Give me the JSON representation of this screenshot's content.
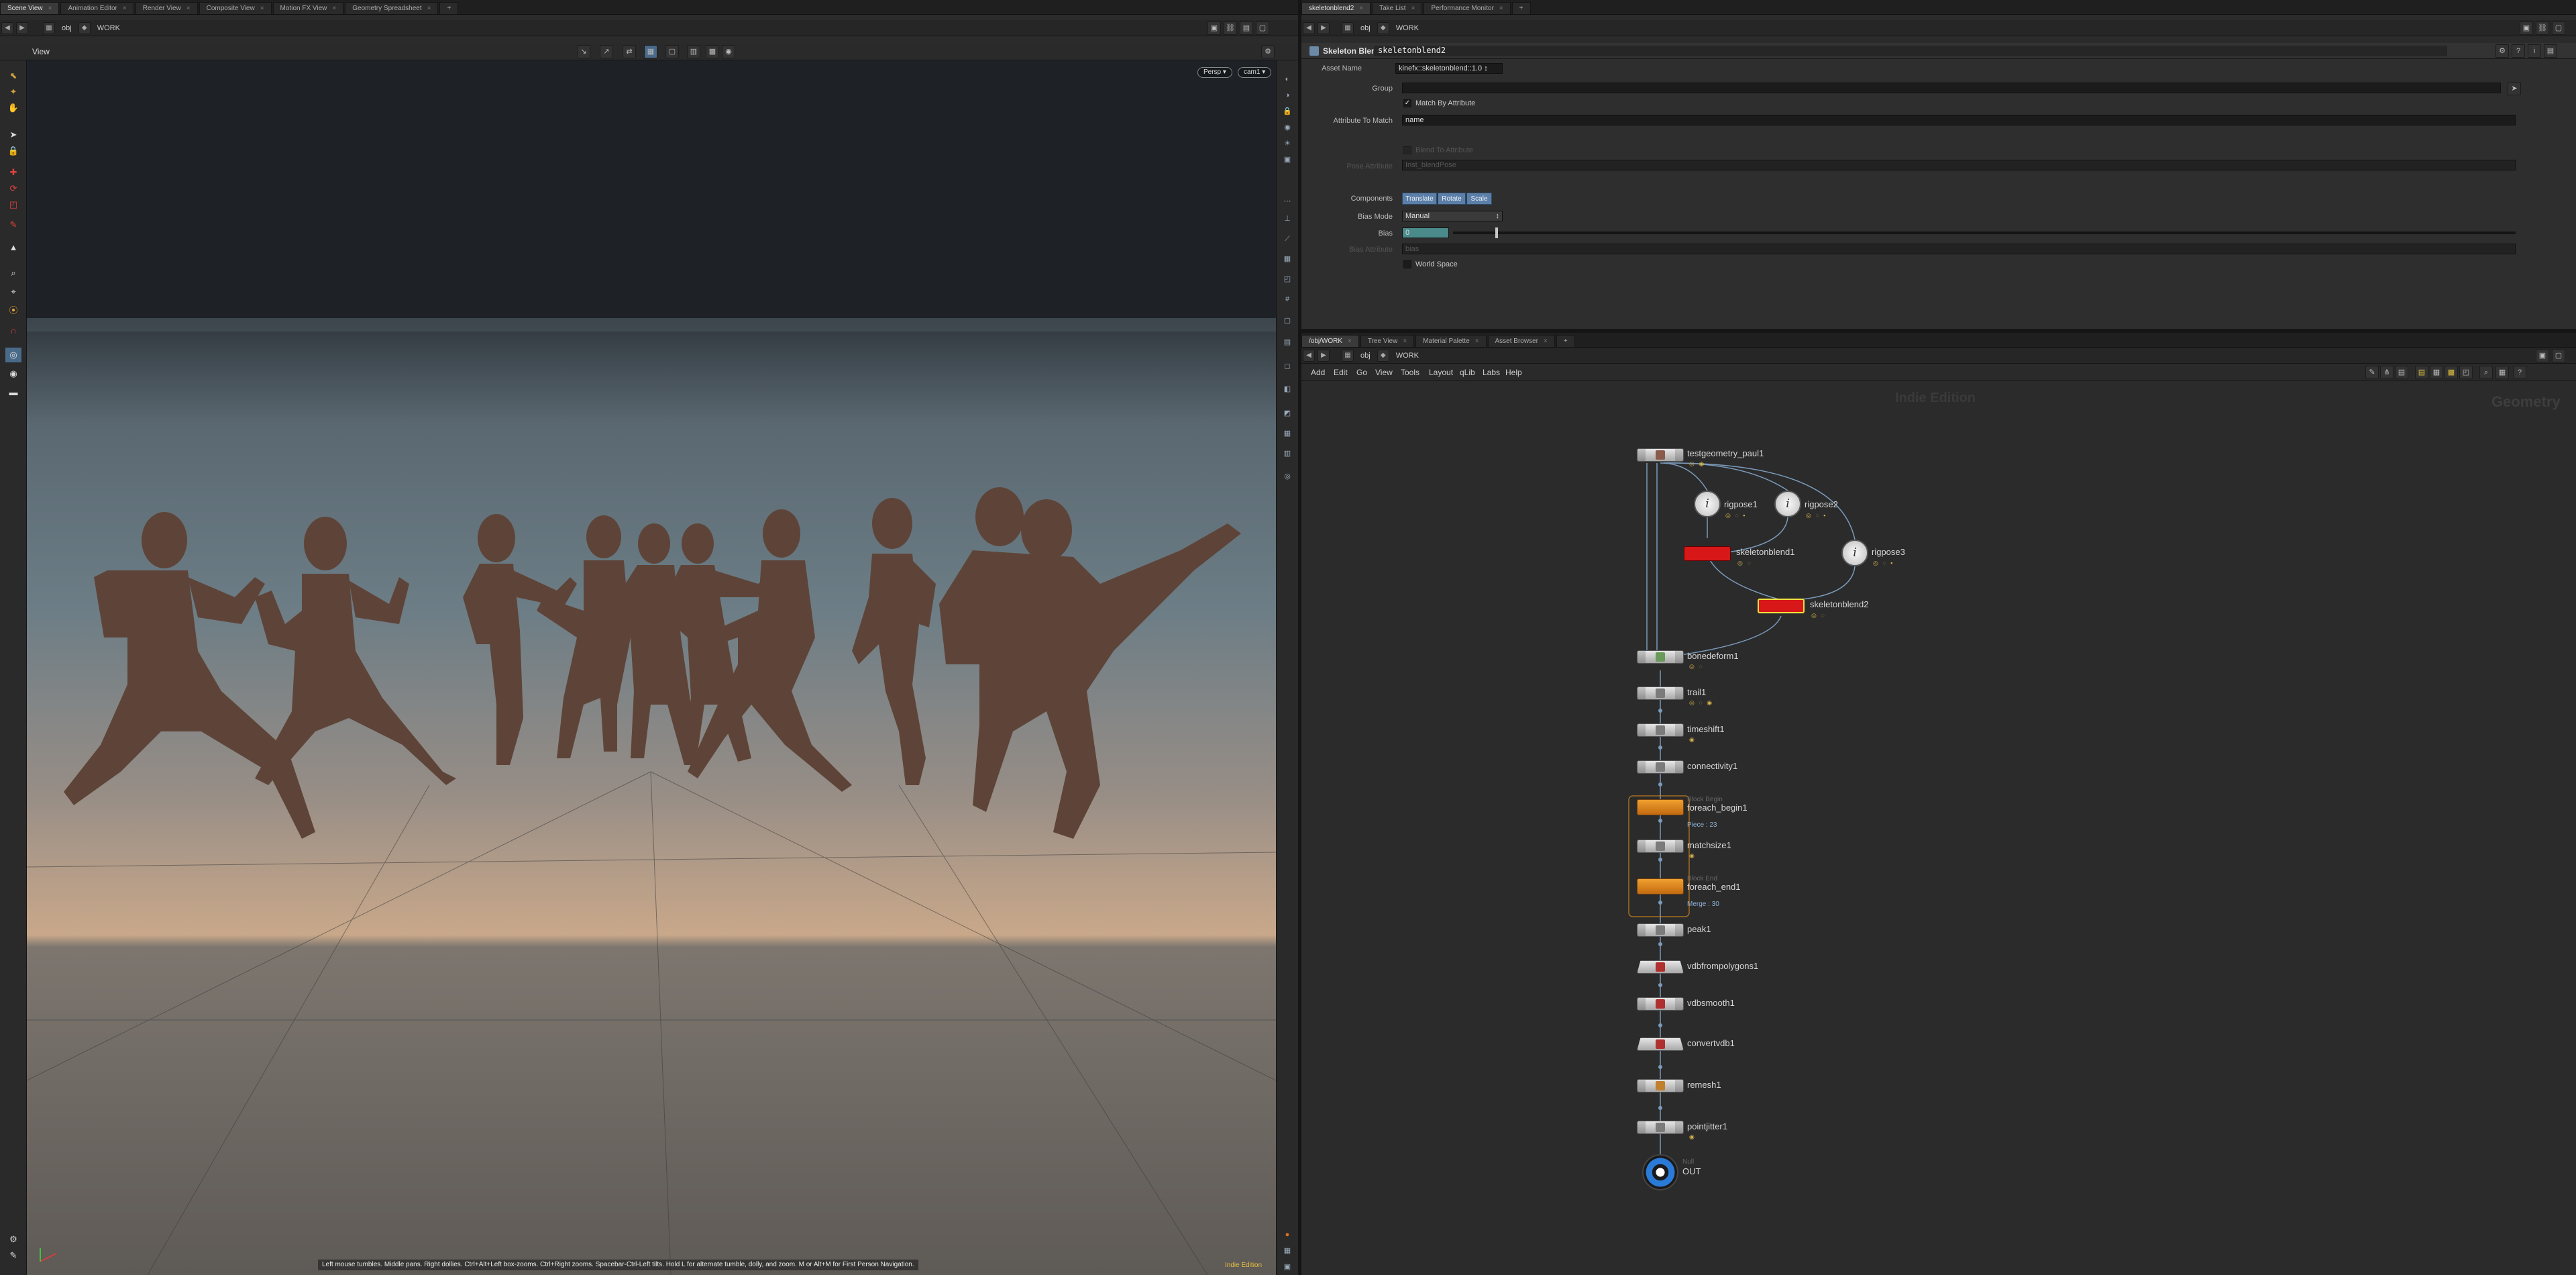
{
  "left_pane": {
    "tabs": [
      {
        "label": "Scene View",
        "active": true
      },
      {
        "label": "Animation Editor"
      },
      {
        "label": "Render View"
      },
      {
        "label": "Composite View"
      },
      {
        "label": "Motion FX View"
      },
      {
        "label": "Geometry Spreadsheet"
      }
    ],
    "path": {
      "context": "obj",
      "node": "WORK"
    },
    "viewer": {
      "title": "View",
      "camera_menu": "Persp",
      "cam_menu": "cam1",
      "status_hint": "Left mouse tumbles. Middle pans. Right dollies. Ctrl+Alt+Left box-zooms. Ctrl+Right zooms. Spacebar-Ctrl-Left tilts. Hold L for alternate tumble, dolly, and zoom.    M or Alt+M for First Person Navigation.",
      "edition": "Indie Edition"
    }
  },
  "right_top": {
    "tabs": [
      {
        "label": "skeletonblend2",
        "active": true
      },
      {
        "label": "Take List"
      },
      {
        "label": "Performance Monitor"
      }
    ],
    "path": {
      "context": "obj",
      "node": "WORK"
    },
    "node_type": "Skeleton Blend",
    "node_name": "skeletonblend2",
    "asset_name_label": "Asset Name",
    "asset_name_value": "kinefx::skeletonblend::1.0",
    "params": {
      "group_label": "Group",
      "group_value": "",
      "match_by_attr_label": "Match By Attribute",
      "attr_to_match_label": "Attribute To Match",
      "attr_to_match_value": "name",
      "blend_to_attr_label": "Blend To Attribute",
      "pose_attr_label": "Pose Attribute",
      "pose_attr_value": "Inst_blendPose",
      "components_label": "Components",
      "components": [
        "Translate",
        "Rotate",
        "Scale"
      ],
      "bias_mode_label": "Bias Mode",
      "bias_mode_value": "Manual",
      "bias_label": "Bias",
      "bias_value": "0",
      "bias_fill": 0.04,
      "bias_attr_label": "Bias Attribute",
      "bias_attr_value": "bias",
      "world_space_label": "World Space"
    }
  },
  "right_bottom": {
    "tabs": [
      {
        "label": "/obj/WORK",
        "active": true
      },
      {
        "label": "Tree View"
      },
      {
        "label": "Material Palette"
      },
      {
        "label": "Asset Browser"
      }
    ],
    "path": {
      "context": "obj",
      "node": "WORK"
    },
    "menu": [
      "Add",
      "Edit",
      "Go",
      "View",
      "Tools",
      "Layout",
      "qLib",
      "Labs",
      "Help"
    ],
    "watermark": "Indie Edition",
    "context_label": "Geometry",
    "nodes": {
      "testgeometry": "testgeometry_paul1",
      "rigpose1": "rigpose1",
      "rigpose2": "rigpose2",
      "rigpose3": "rigpose3",
      "skeletonblend1": "skeletonblend1",
      "skeletonblend2": "skeletonblend2",
      "bonedeform1": "bonedeform1",
      "trail1": "trail1",
      "timeshift1": "timeshift1",
      "connectivity1": "connectivity1",
      "foreach_begin_tag": "Block Begin",
      "foreach_begin1": "foreach_begin1",
      "foreach_begin_sub": "Piece : 23",
      "matchsize1": "matchsize1",
      "foreach_end_tag": "Block End",
      "foreach_end1": "foreach_end1",
      "foreach_end_sub": "Merge : 30",
      "peak1": "peak1",
      "vdbfrompolygons1": "vdbfrompolygons1",
      "vdbsmooth1": "vdbsmooth1",
      "convertvdb1": "convertvdb1",
      "remesh1": "remesh1",
      "pointjitter1": "pointjitter1",
      "out_tag": "Null",
      "out": "OUT"
    }
  },
  "colors": {
    "sky_top": "#1e2328",
    "horizon": "#5c6b74",
    "floor_warm": "#c9a88a",
    "figure": "#5e4438",
    "selected_node": "#d81818",
    "foreach_node": "#e88a20",
    "accent_blue": "#5c7fa8"
  },
  "icons": {
    "back": "arrow-left-icon",
    "forward": "arrow-right-icon",
    "home": "home-icon",
    "gear": "gear-icon",
    "help": "help-icon"
  }
}
